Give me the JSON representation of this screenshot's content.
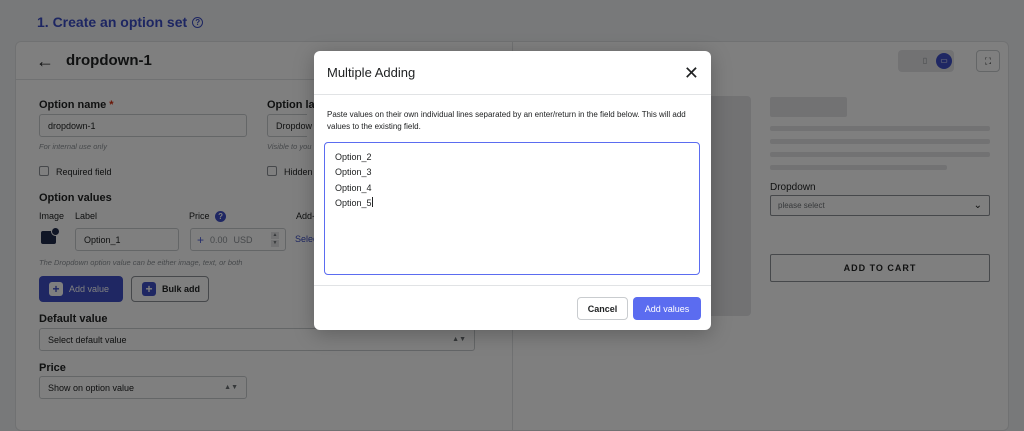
{
  "section": {
    "title": "1. Create an option set"
  },
  "option": {
    "title": "dropdown-1",
    "name_label": "Option name",
    "name_required_mark": "*",
    "name_value": "dropdown-1",
    "name_hint": "For internal use only",
    "label_label": "Option lab",
    "label_value": "Dropdow",
    "label_hint": "Visible to you",
    "required_field_label": "Required field",
    "hidden_label": "Hidden",
    "values_heading": "Option values",
    "col_image": "Image",
    "col_label": "Label",
    "col_price": "Price",
    "col_addon": "Add-",
    "row_label_value": "Option_1",
    "row_price_placeholder": "0.00",
    "row_currency": "USD",
    "row_select_link": "Selec",
    "values_hint": "The Dropdown option value can be either image, text, or both",
    "add_value_label": "Add value",
    "bulk_add_label": "Bulk add",
    "default_value_heading": "Default value",
    "default_value_select": "Select default value",
    "price_heading": "Price",
    "price_select": "Show on option value"
  },
  "preview": {
    "dropdown_label": "Dropdown",
    "dropdown_placeholder": "please select",
    "add_to_cart": "ADD TO CART"
  },
  "modal": {
    "title": "Multiple Adding",
    "description": "Paste values on their own individual lines separated by an enter/return in the field below. This will add values to the existing field.",
    "lines": [
      "Option_2",
      "Option_3",
      "Option_4",
      "Option_5"
    ],
    "cancel_label": "Cancel",
    "submit_label": "Add values"
  }
}
